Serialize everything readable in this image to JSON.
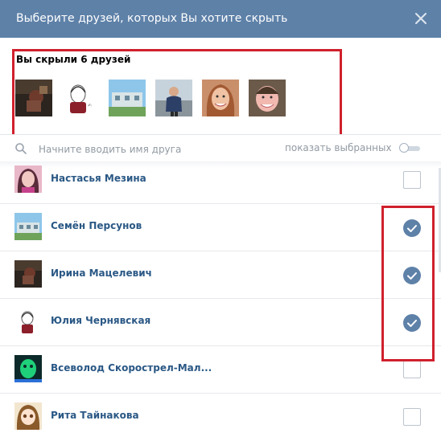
{
  "header": {
    "title": "Выберите друзей, которых Вы хотите скрыть",
    "background": "#5e81a8"
  },
  "hidden": {
    "title": "Вы скрыли 6 друзей",
    "avatars": [
      {
        "icon": "avatar-photo-dark-hand"
      },
      {
        "icon": "avatar-drawing-girl"
      },
      {
        "icon": "avatar-building-blue"
      },
      {
        "icon": "avatar-man-outdoor"
      },
      {
        "icon": "avatar-woman-smiling"
      },
      {
        "icon": "avatar-woman-pink"
      }
    ]
  },
  "search": {
    "placeholder": "Начните вводить имя друга",
    "show_selected_label": "показать выбранных",
    "show_selected_on": false
  },
  "friends": [
    {
      "name": "Настасья Мезина",
      "checked": false,
      "icon": "avatar-girl-pink"
    },
    {
      "name": "Семён Персунов",
      "checked": true,
      "icon": "avatar-building-blue"
    },
    {
      "name": "Ирина Мацелевич",
      "checked": true,
      "icon": "avatar-photo-dark-hand"
    },
    {
      "name": "Юлия Чернявская",
      "checked": true,
      "icon": "avatar-drawing-girl"
    },
    {
      "name": "Всеволод Скорострел-Мал...",
      "checked": false,
      "icon": "avatar-green-glow"
    },
    {
      "name": "Рита Тайнакова",
      "checked": false,
      "icon": "avatar-anime-girl"
    }
  ],
  "colors": {
    "accent": "#5e81a8",
    "link": "#2a5885",
    "highlight": "#d0202c"
  }
}
